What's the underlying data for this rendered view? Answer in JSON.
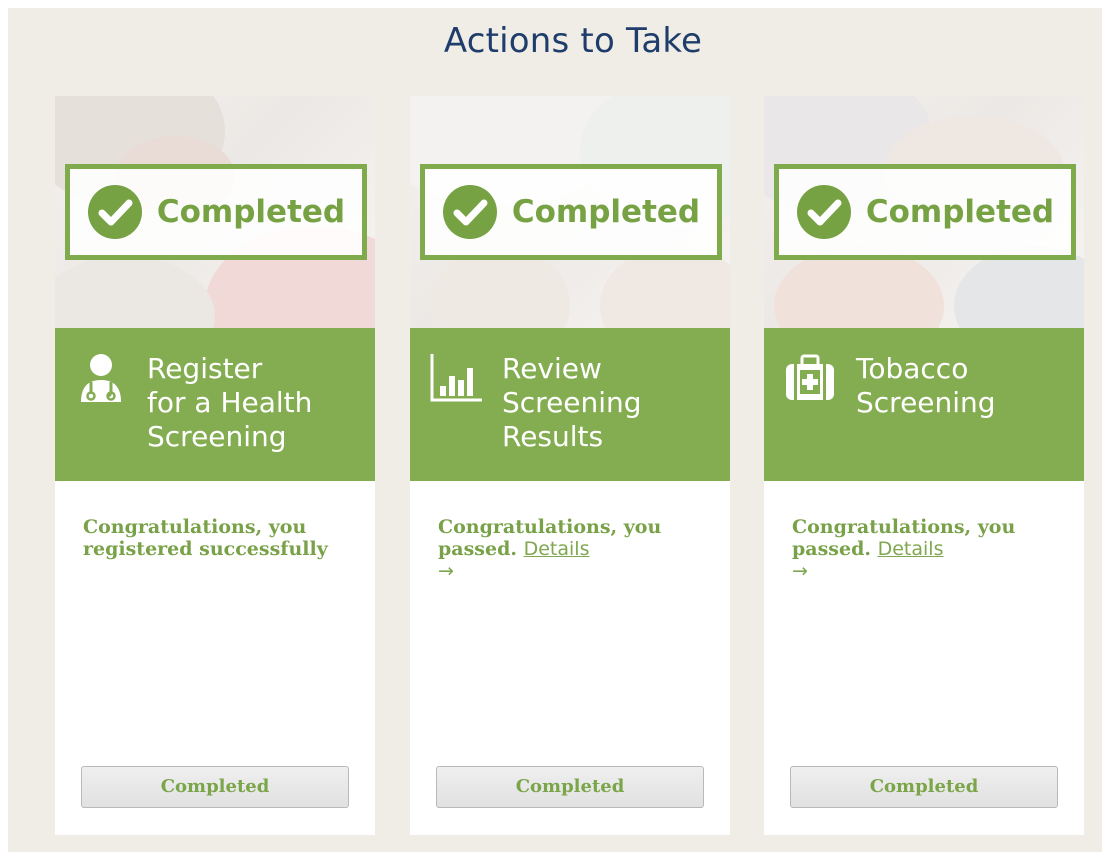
{
  "page": {
    "title": "Actions to Take"
  },
  "theme": {
    "accent_green": "#84ad52",
    "text_green": "#78a148",
    "title_blue": "#1f3d6b",
    "page_bg": "#f0ede6"
  },
  "cards": [
    {
      "badge_label": "Completed",
      "badge_icon": "check-circle-icon",
      "task_icon": "doctor-icon",
      "task_title_lines": [
        "Register",
        "for a Health",
        "Screening"
      ],
      "message": "Congratulations, you registered successfully",
      "link_label": "",
      "button_label": "Completed"
    },
    {
      "badge_label": "Completed",
      "badge_icon": "check-circle-icon",
      "task_icon": "bar-chart-icon",
      "task_title_lines": [
        "Review",
        "Screening",
        "Results"
      ],
      "message": "Congratulations, you passed.",
      "link_label": "Details",
      "link_arrow": "→",
      "button_label": "Completed"
    },
    {
      "badge_label": "Completed",
      "badge_icon": "check-circle-icon",
      "task_icon": "medical-kit-icon",
      "task_title_lines": [
        "Tobacco",
        "Screening"
      ],
      "message": "Congratulations, you passed.",
      "link_label": "Details",
      "link_arrow": "→",
      "button_label": "Completed"
    }
  ]
}
